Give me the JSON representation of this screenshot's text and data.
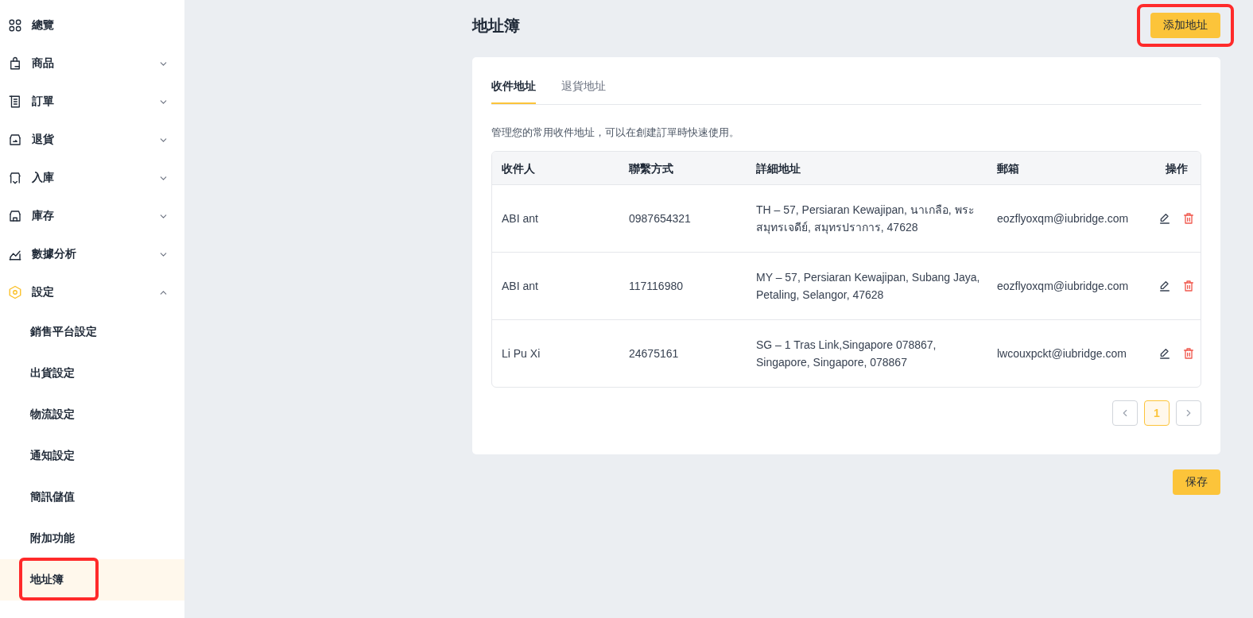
{
  "sidebar": {
    "items": [
      {
        "label": "總覽"
      },
      {
        "label": "商品",
        "expanded": false
      },
      {
        "label": "訂單",
        "expanded": false
      },
      {
        "label": "退貨",
        "expanded": false
      },
      {
        "label": "入庫",
        "expanded": false
      },
      {
        "label": "庫存",
        "expanded": false
      },
      {
        "label": "數據分析",
        "expanded": false
      },
      {
        "label": "設定",
        "expanded": true,
        "children": [
          {
            "label": "銷售平台設定",
            "selected": false,
            "highlighted": false
          },
          {
            "label": "出貨設定",
            "selected": false,
            "highlighted": false
          },
          {
            "label": "物流設定",
            "selected": false,
            "highlighted": false
          },
          {
            "label": "通知設定",
            "selected": false,
            "highlighted": false
          },
          {
            "label": "簡訊儲值",
            "selected": false,
            "highlighted": false
          },
          {
            "label": "附加功能",
            "selected": false,
            "highlighted": false
          },
          {
            "label": "地址簿",
            "selected": true,
            "highlighted": true
          }
        ]
      }
    ]
  },
  "page": {
    "title": "地址簿",
    "add_button": {
      "label": "添加地址",
      "highlighted": true
    },
    "tabs": [
      {
        "label": "收件地址",
        "selected": true
      },
      {
        "label": "退貨地址",
        "selected": false
      }
    ],
    "description": "管理您的常用收件地址，可以在創建訂單時快速使用。",
    "table": {
      "columns": [
        "收件人",
        "聯繫方式",
        "詳細地址",
        "郵箱",
        "操作"
      ],
      "rows": [
        {
          "name": "ABI ant",
          "phone": "0987654321",
          "address": "TH – 57, Persiaran Kewajipan, นาเกลือ, พระสมุทรเจดีย์, สมุทรปราการ, 47628",
          "email": "eozflyoxqm@iubridge.com"
        },
        {
          "name": "ABI ant",
          "phone": "117116980",
          "address": "MY – 57, Persiaran Kewajipan, Subang Jaya, Petaling, Selangor, 47628",
          "email": "eozflyoxqm@iubridge.com"
        },
        {
          "name": "Li Pu Xi",
          "phone": "24675161",
          "address": "SG – 1 Tras Link,Singapore 078867, Singapore, Singapore, 078867",
          "email": "lwcouxpckt@iubridge.com"
        }
      ]
    },
    "pagination": {
      "pages": [
        {
          "label": "1",
          "selected": true
        }
      ]
    },
    "save_button": "保存"
  }
}
